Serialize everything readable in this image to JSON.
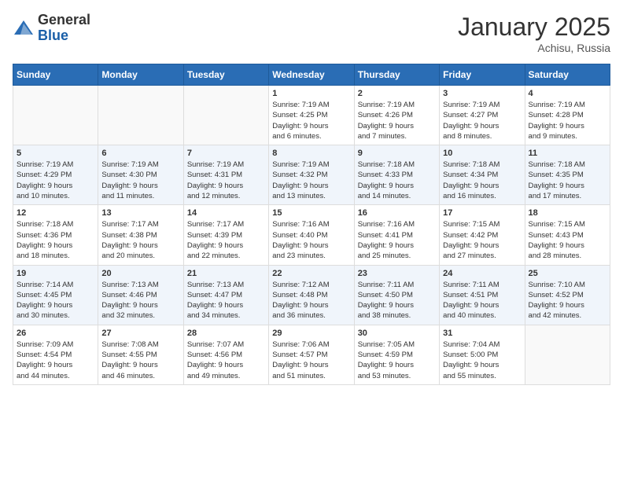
{
  "header": {
    "logo": {
      "general": "General",
      "blue": "Blue"
    },
    "title": "January 2025",
    "location": "Achisu, Russia"
  },
  "calendar": {
    "days_of_week": [
      "Sunday",
      "Monday",
      "Tuesday",
      "Wednesday",
      "Thursday",
      "Friday",
      "Saturday"
    ],
    "weeks": [
      [
        {
          "day": "",
          "content": ""
        },
        {
          "day": "",
          "content": ""
        },
        {
          "day": "",
          "content": ""
        },
        {
          "day": "1",
          "content": "Sunrise: 7:19 AM\nSunset: 4:25 PM\nDaylight: 9 hours\nand 6 minutes."
        },
        {
          "day": "2",
          "content": "Sunrise: 7:19 AM\nSunset: 4:26 PM\nDaylight: 9 hours\nand 7 minutes."
        },
        {
          "day": "3",
          "content": "Sunrise: 7:19 AM\nSunset: 4:27 PM\nDaylight: 9 hours\nand 8 minutes."
        },
        {
          "day": "4",
          "content": "Sunrise: 7:19 AM\nSunset: 4:28 PM\nDaylight: 9 hours\nand 9 minutes."
        }
      ],
      [
        {
          "day": "5",
          "content": "Sunrise: 7:19 AM\nSunset: 4:29 PM\nDaylight: 9 hours\nand 10 minutes."
        },
        {
          "day": "6",
          "content": "Sunrise: 7:19 AM\nSunset: 4:30 PM\nDaylight: 9 hours\nand 11 minutes."
        },
        {
          "day": "7",
          "content": "Sunrise: 7:19 AM\nSunset: 4:31 PM\nDaylight: 9 hours\nand 12 minutes."
        },
        {
          "day": "8",
          "content": "Sunrise: 7:19 AM\nSunset: 4:32 PM\nDaylight: 9 hours\nand 13 minutes."
        },
        {
          "day": "9",
          "content": "Sunrise: 7:18 AM\nSunset: 4:33 PM\nDaylight: 9 hours\nand 14 minutes."
        },
        {
          "day": "10",
          "content": "Sunrise: 7:18 AM\nSunset: 4:34 PM\nDaylight: 9 hours\nand 16 minutes."
        },
        {
          "day": "11",
          "content": "Sunrise: 7:18 AM\nSunset: 4:35 PM\nDaylight: 9 hours\nand 17 minutes."
        }
      ],
      [
        {
          "day": "12",
          "content": "Sunrise: 7:18 AM\nSunset: 4:36 PM\nDaylight: 9 hours\nand 18 minutes."
        },
        {
          "day": "13",
          "content": "Sunrise: 7:17 AM\nSunset: 4:38 PM\nDaylight: 9 hours\nand 20 minutes."
        },
        {
          "day": "14",
          "content": "Sunrise: 7:17 AM\nSunset: 4:39 PM\nDaylight: 9 hours\nand 22 minutes."
        },
        {
          "day": "15",
          "content": "Sunrise: 7:16 AM\nSunset: 4:40 PM\nDaylight: 9 hours\nand 23 minutes."
        },
        {
          "day": "16",
          "content": "Sunrise: 7:16 AM\nSunset: 4:41 PM\nDaylight: 9 hours\nand 25 minutes."
        },
        {
          "day": "17",
          "content": "Sunrise: 7:15 AM\nSunset: 4:42 PM\nDaylight: 9 hours\nand 27 minutes."
        },
        {
          "day": "18",
          "content": "Sunrise: 7:15 AM\nSunset: 4:43 PM\nDaylight: 9 hours\nand 28 minutes."
        }
      ],
      [
        {
          "day": "19",
          "content": "Sunrise: 7:14 AM\nSunset: 4:45 PM\nDaylight: 9 hours\nand 30 minutes."
        },
        {
          "day": "20",
          "content": "Sunrise: 7:13 AM\nSunset: 4:46 PM\nDaylight: 9 hours\nand 32 minutes."
        },
        {
          "day": "21",
          "content": "Sunrise: 7:13 AM\nSunset: 4:47 PM\nDaylight: 9 hours\nand 34 minutes."
        },
        {
          "day": "22",
          "content": "Sunrise: 7:12 AM\nSunset: 4:48 PM\nDaylight: 9 hours\nand 36 minutes."
        },
        {
          "day": "23",
          "content": "Sunrise: 7:11 AM\nSunset: 4:50 PM\nDaylight: 9 hours\nand 38 minutes."
        },
        {
          "day": "24",
          "content": "Sunrise: 7:11 AM\nSunset: 4:51 PM\nDaylight: 9 hours\nand 40 minutes."
        },
        {
          "day": "25",
          "content": "Sunrise: 7:10 AM\nSunset: 4:52 PM\nDaylight: 9 hours\nand 42 minutes."
        }
      ],
      [
        {
          "day": "26",
          "content": "Sunrise: 7:09 AM\nSunset: 4:54 PM\nDaylight: 9 hours\nand 44 minutes."
        },
        {
          "day": "27",
          "content": "Sunrise: 7:08 AM\nSunset: 4:55 PM\nDaylight: 9 hours\nand 46 minutes."
        },
        {
          "day": "28",
          "content": "Sunrise: 7:07 AM\nSunset: 4:56 PM\nDaylight: 9 hours\nand 49 minutes."
        },
        {
          "day": "29",
          "content": "Sunrise: 7:06 AM\nSunset: 4:57 PM\nDaylight: 9 hours\nand 51 minutes."
        },
        {
          "day": "30",
          "content": "Sunrise: 7:05 AM\nSunset: 4:59 PM\nDaylight: 9 hours\nand 53 minutes."
        },
        {
          "day": "31",
          "content": "Sunrise: 7:04 AM\nSunset: 5:00 PM\nDaylight: 9 hours\nand 55 minutes."
        },
        {
          "day": "",
          "content": ""
        }
      ]
    ]
  }
}
